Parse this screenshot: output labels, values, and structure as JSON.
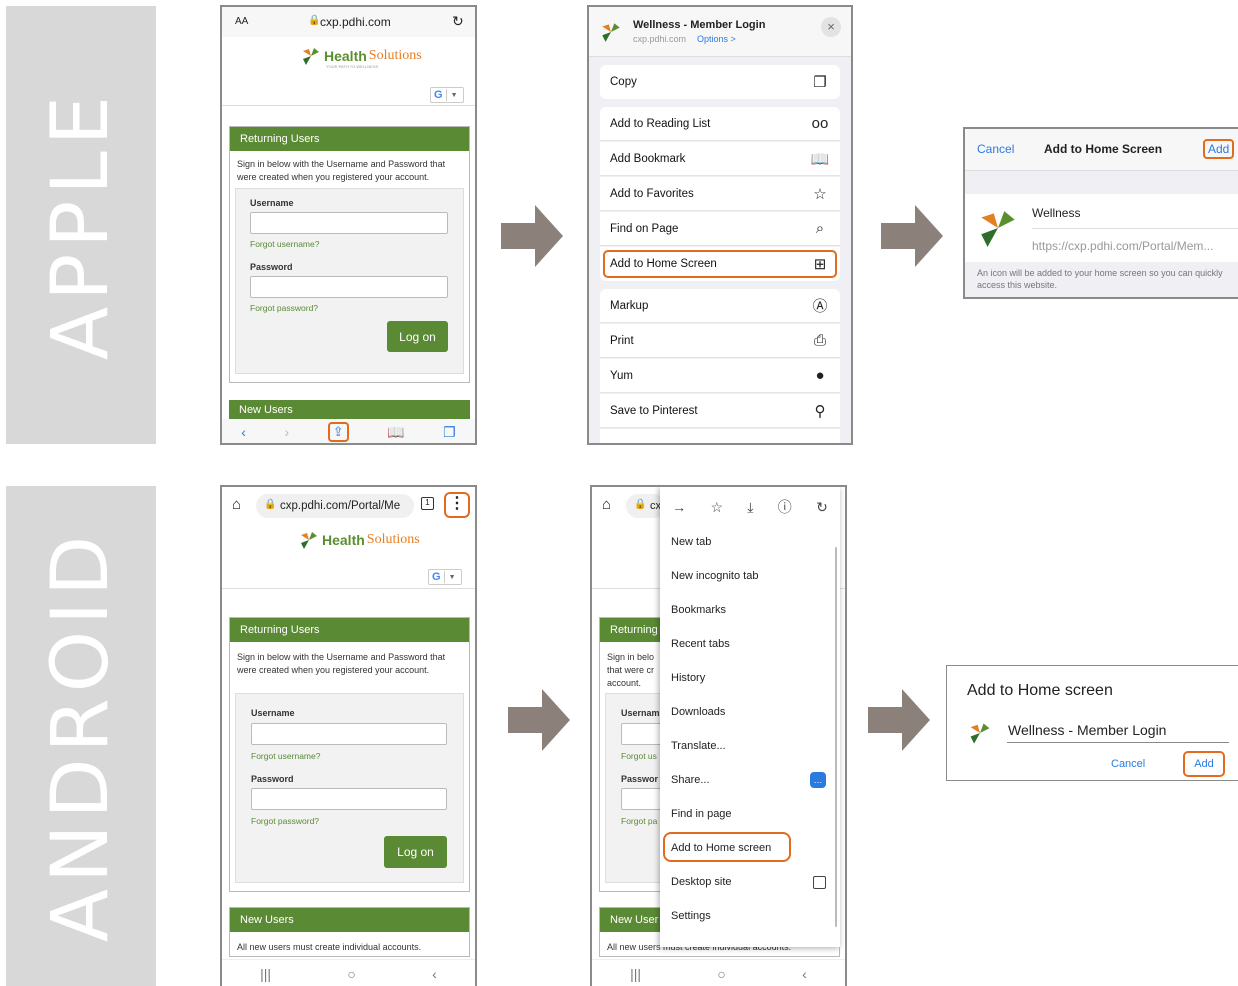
{
  "labels": {
    "apple": "APPLE",
    "android": "ANDROID"
  },
  "colors": {
    "highlight": "#e26b1f",
    "brand_green": "#5b8a34",
    "arrow": "#8c807b",
    "ios_blue": "#2a7bde"
  },
  "site": {
    "brand_word1": "Health",
    "brand_word2": "Solutions",
    "brand_tagline": "YOUR PATH TO WELLNESS",
    "google_g": "G",
    "returning_users": "Returning Users",
    "intro_ios": "Sign in below with the Username and Password that were created when you registered your account.",
    "intro_android": "Sign in below with the Username and Password that were created when you registered your account.",
    "username": "Username",
    "forgot_username": "Forgot username?",
    "password": "Password",
    "forgot_password": "Forgot password?",
    "logon": "Log on",
    "new_users": "New Users",
    "new_users_text": "All new users must create individual accounts."
  },
  "ios_browser": {
    "aa": "AA",
    "url": "cxp.pdhi.com"
  },
  "ios_share": {
    "title": "Wellness - Member Login",
    "subtitle": "cxp.pdhi.com",
    "options": "Options >",
    "items": [
      "Copy",
      "Add to Reading List",
      "Add Bookmark",
      "Add to Favorites",
      "Find on Page",
      "Add to Home Screen",
      "Markup",
      "Print",
      "Yum",
      "Save to Pinterest"
    ]
  },
  "ios_add": {
    "cancel": "Cancel",
    "title": "Add to Home Screen",
    "add": "Add",
    "name": "Wellness",
    "url": "https://cxp.pdhi.com/Portal/Mem...",
    "note": "An icon will be added to your home screen so you can quickly access this website."
  },
  "android_browser": {
    "url": "cxp.pdhi.com/Portal/Me",
    "url_partial": "cx"
  },
  "android_menu": {
    "items": [
      "New tab",
      "New incognito tab",
      "Bookmarks",
      "Recent tabs",
      "History",
      "Downloads",
      "Translate...",
      "Share...",
      "Find in page",
      "Add to Home screen",
      "Desktop site",
      "Settings"
    ]
  },
  "android_behind": {
    "returning": "Returning",
    "line1": "Sign in belo",
    "line2": "that were cr",
    "line3": "account.",
    "username": "Usernam",
    "forgot_user": "Forgot us",
    "password": "Passwor",
    "forgot_pass": "Forgot pa",
    "new_users": "New User",
    "new_users_text": "All new users must create individual accounts."
  },
  "android_add": {
    "title": "Add to Home screen",
    "name": "Wellness - Member Login",
    "cancel": "Cancel",
    "add": "Add"
  }
}
